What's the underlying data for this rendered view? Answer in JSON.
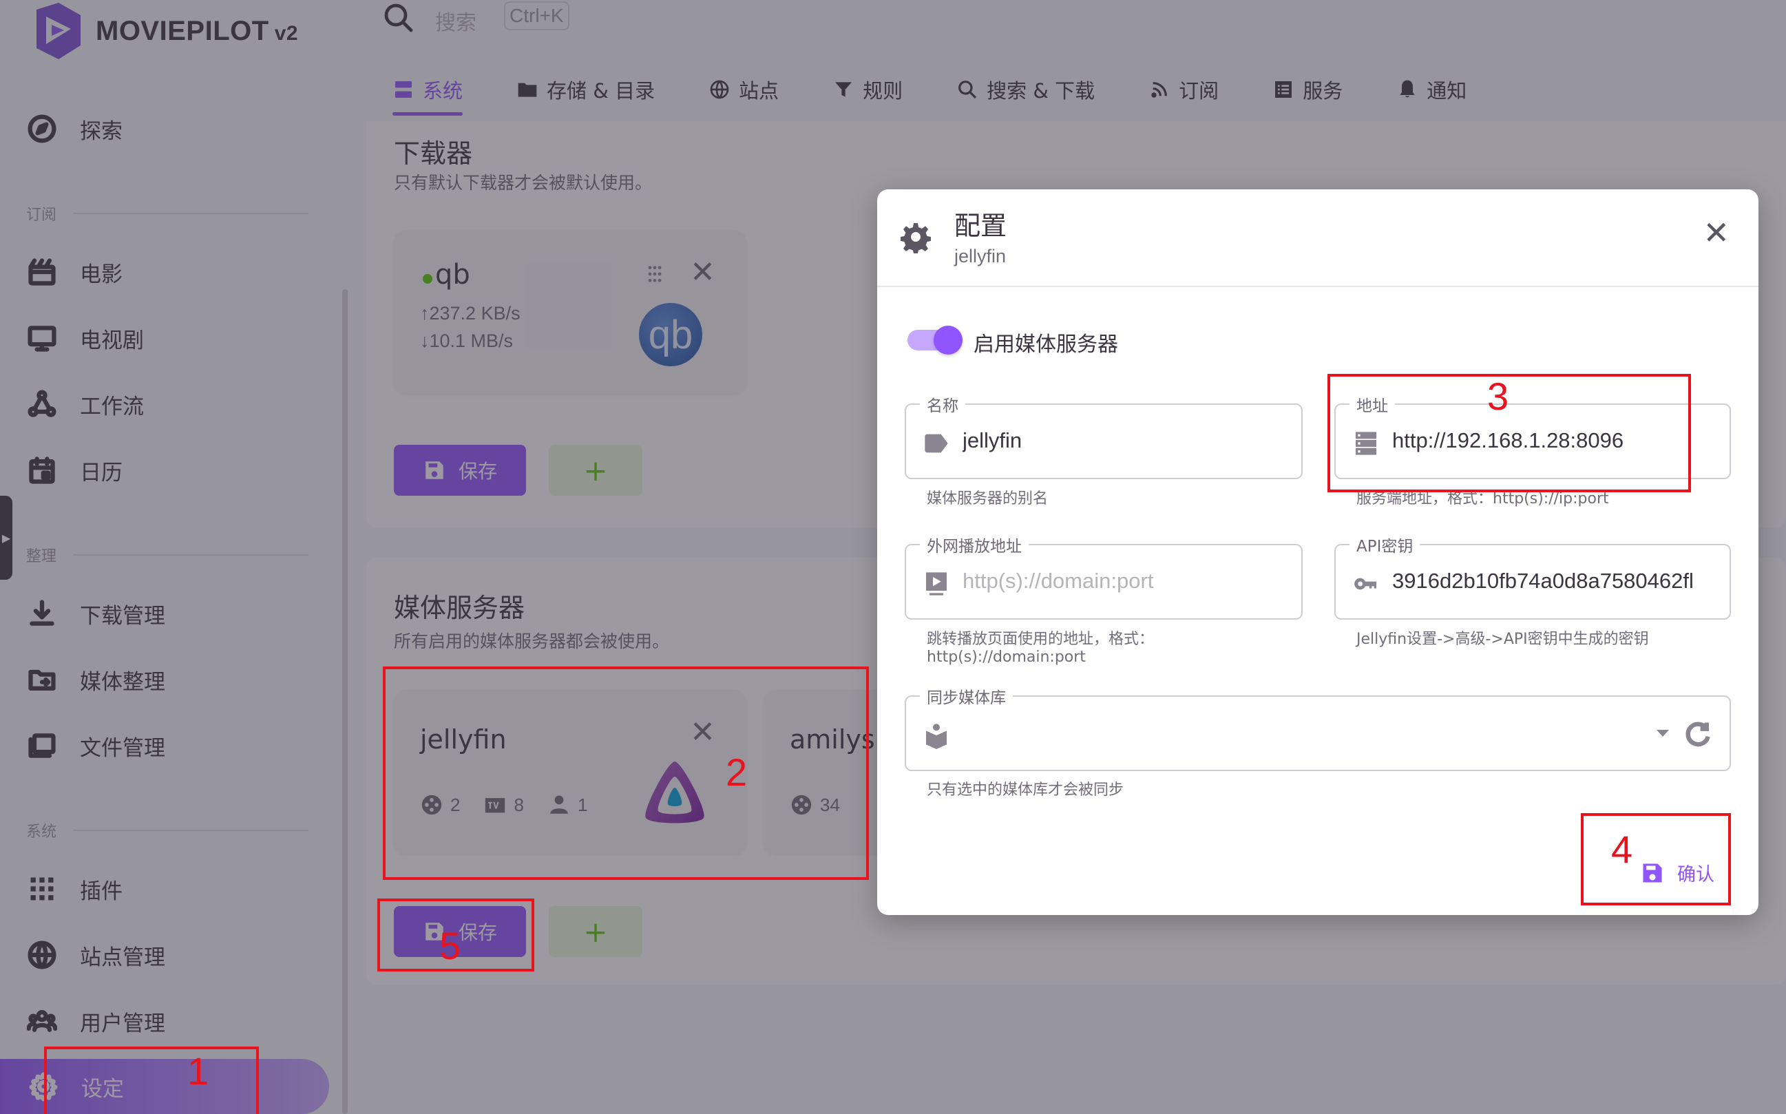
{
  "app": {
    "brand": "MOVIEPILOT",
    "brand_version": "v2"
  },
  "search": {
    "placeholder": "搜索",
    "shortcut": "Ctrl+K"
  },
  "sidebar": {
    "items": [
      {
        "label": "探索",
        "icon": "compass-icon"
      },
      {
        "label": "电影",
        "icon": "movie-clapper-icon"
      },
      {
        "label": "电视剧",
        "icon": "monitor-icon"
      },
      {
        "label": "工作流",
        "icon": "workflow-icon"
      },
      {
        "label": "日历",
        "icon": "calendar-icon"
      },
      {
        "label": "下载管理",
        "icon": "download-icon"
      },
      {
        "label": "媒体整理",
        "icon": "folder-move-icon"
      },
      {
        "label": "文件管理",
        "icon": "files-icon"
      },
      {
        "label": "插件",
        "icon": "grid-icon"
      },
      {
        "label": "站点管理",
        "icon": "globe-icon"
      },
      {
        "label": "用户管理",
        "icon": "users-icon"
      },
      {
        "label": "设定",
        "icon": "gear-icon"
      }
    ],
    "sections": {
      "subscribe": "订阅",
      "organize": "整理",
      "system": "系统"
    }
  },
  "tabs": [
    {
      "label": "系统",
      "icon": "server-icon",
      "active": true
    },
    {
      "label": "存储 & 目录",
      "icon": "folder-icon"
    },
    {
      "label": "站点",
      "icon": "globe-icon"
    },
    {
      "label": "规则",
      "icon": "filter-icon"
    },
    {
      "label": "搜索 & 下载",
      "icon": "search-icon"
    },
    {
      "label": "订阅",
      "icon": "rss-icon"
    },
    {
      "label": "服务",
      "icon": "list-icon"
    },
    {
      "label": "通知",
      "icon": "bell-icon"
    }
  ],
  "downloader": {
    "title": "下载器",
    "subtitle": "只有默认下载器才会被默认使用。",
    "client": {
      "name": "qb",
      "logo_text": "qb",
      "upload": "↑237.2 KB/s",
      "download": "↓10.1 MB/s",
      "status_color": "#56ca00"
    },
    "save_label": "保存",
    "add_label": "+"
  },
  "media_server": {
    "title": "媒体服务器",
    "subtitle": "所有启用的媒体服务器都会被使用。",
    "servers": [
      {
        "name": "jellyfin",
        "movies": "2",
        "tv": "8",
        "users": "1"
      },
      {
        "name": "amilys",
        "movies": "34"
      }
    ],
    "save_label": "保存",
    "add_label": "+"
  },
  "dialog": {
    "title": "配置",
    "subtitle": "jellyfin",
    "enable_label": "启用媒体服务器",
    "enabled": true,
    "name_label": "名称",
    "name_value": "jellyfin",
    "name_hint": "媒体服务器的别名",
    "address_label": "地址",
    "address_value": "http://192.168.1.28:8096",
    "address_hint": "服务端地址，格式：http(s)://ip:port",
    "public_label": "外网播放地址",
    "public_placeholder": "http(s)://domain:port",
    "public_hint_1": "跳转播放页面使用的地址，格式：",
    "public_hint_2": "http(s)://domain:port",
    "apikey_label": "API密钥",
    "apikey_value": "3916d2b10fb74a0d8a7580462fl",
    "apikey_hint": "Jellyfin设置->高级->API密钥中生成的密钥",
    "library_label": "同步媒体库",
    "library_hint": "只有选中的媒体库才会被同步",
    "confirm_label": "确认"
  },
  "annotations": [
    "1",
    "2",
    "3",
    "4",
    "5"
  ],
  "colors": {
    "primary": "#9155fd",
    "annotation": "#e8131d",
    "success": "#56ca00"
  }
}
